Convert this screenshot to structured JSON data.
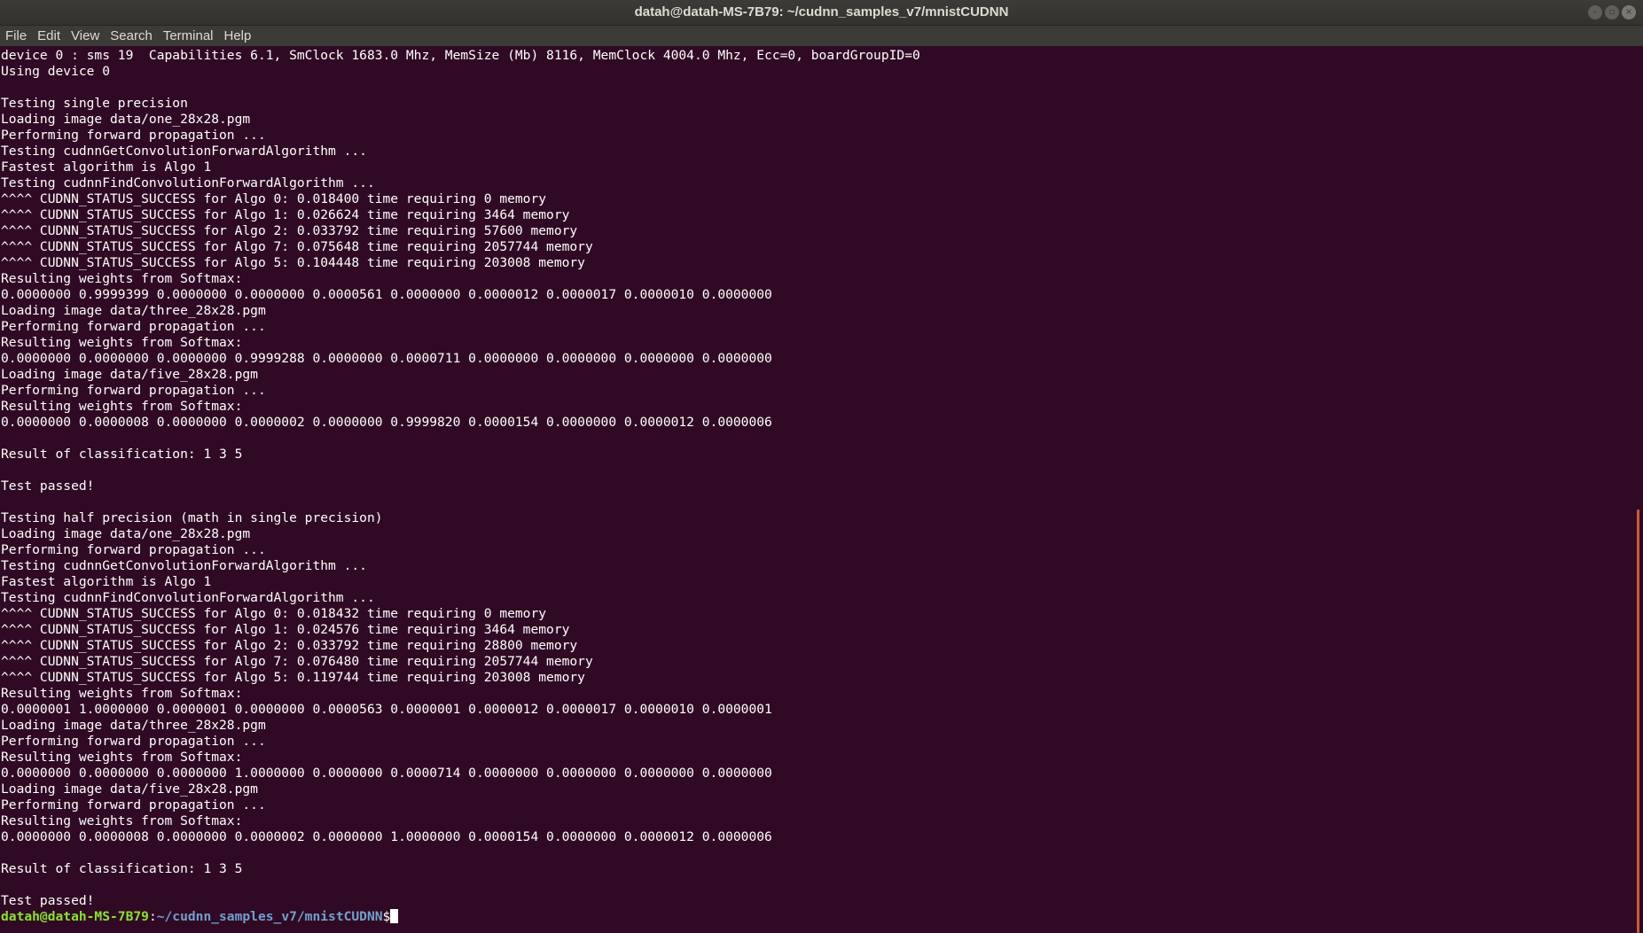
{
  "window": {
    "title": "datah@datah-MS-7B79: ~/cudnn_samples_v7/mnistCUDNN",
    "buttons": {
      "minimize": "–",
      "maximize": "▫",
      "close": "×"
    }
  },
  "menubar": {
    "items": [
      "File",
      "Edit",
      "View",
      "Search",
      "Terminal",
      "Help"
    ]
  },
  "terminal": {
    "lines": [
      "device 0 : sms 19  Capabilities 6.1, SmClock 1683.0 Mhz, MemSize (Mb) 8116, MemClock 4004.0 Mhz, Ecc=0, boardGroupID=0",
      "Using device 0",
      "",
      "Testing single precision",
      "Loading image data/one_28x28.pgm",
      "Performing forward propagation ...",
      "Testing cudnnGetConvolutionForwardAlgorithm ...",
      "Fastest algorithm is Algo 1",
      "Testing cudnnFindConvolutionForwardAlgorithm ...",
      "^^^^ CUDNN_STATUS_SUCCESS for Algo 0: 0.018400 time requiring 0 memory",
      "^^^^ CUDNN_STATUS_SUCCESS for Algo 1: 0.026624 time requiring 3464 memory",
      "^^^^ CUDNN_STATUS_SUCCESS for Algo 2: 0.033792 time requiring 57600 memory",
      "^^^^ CUDNN_STATUS_SUCCESS for Algo 7: 0.075648 time requiring 2057744 memory",
      "^^^^ CUDNN_STATUS_SUCCESS for Algo 5: 0.104448 time requiring 203008 memory",
      "Resulting weights from Softmax:",
      "0.0000000 0.9999399 0.0000000 0.0000000 0.0000561 0.0000000 0.0000012 0.0000017 0.0000010 0.0000000",
      "Loading image data/three_28x28.pgm",
      "Performing forward propagation ...",
      "Resulting weights from Softmax:",
      "0.0000000 0.0000000 0.0000000 0.9999288 0.0000000 0.0000711 0.0000000 0.0000000 0.0000000 0.0000000",
      "Loading image data/five_28x28.pgm",
      "Performing forward propagation ...",
      "Resulting weights from Softmax:",
      "0.0000000 0.0000008 0.0000000 0.0000002 0.0000000 0.9999820 0.0000154 0.0000000 0.0000012 0.0000006",
      "",
      "Result of classification: 1 3 5",
      "",
      "Test passed!",
      "",
      "Testing half precision (math in single precision)",
      "Loading image data/one_28x28.pgm",
      "Performing forward propagation ...",
      "Testing cudnnGetConvolutionForwardAlgorithm ...",
      "Fastest algorithm is Algo 1",
      "Testing cudnnFindConvolutionForwardAlgorithm ...",
      "^^^^ CUDNN_STATUS_SUCCESS for Algo 0: 0.018432 time requiring 0 memory",
      "^^^^ CUDNN_STATUS_SUCCESS for Algo 1: 0.024576 time requiring 3464 memory",
      "^^^^ CUDNN_STATUS_SUCCESS for Algo 2: 0.033792 time requiring 28800 memory",
      "^^^^ CUDNN_STATUS_SUCCESS for Algo 7: 0.076480 time requiring 2057744 memory",
      "^^^^ CUDNN_STATUS_SUCCESS for Algo 5: 0.119744 time requiring 203008 memory",
      "Resulting weights from Softmax:",
      "0.0000001 1.0000000 0.0000001 0.0000000 0.0000563 0.0000001 0.0000012 0.0000017 0.0000010 0.0000001",
      "Loading image data/three_28x28.pgm",
      "Performing forward propagation ...",
      "Resulting weights from Softmax:",
      "0.0000000 0.0000000 0.0000000 1.0000000 0.0000000 0.0000714 0.0000000 0.0000000 0.0000000 0.0000000",
      "Loading image data/five_28x28.pgm",
      "Performing forward propagation ...",
      "Resulting weights from Softmax:",
      "0.0000000 0.0000008 0.0000000 0.0000002 0.0000000 1.0000000 0.0000154 0.0000000 0.0000012 0.0000006",
      "",
      "Result of classification: 1 3 5",
      "",
      "Test passed!"
    ],
    "prompt": {
      "user_host": "datah@datah-MS-7B79",
      "separator": ":",
      "path": "~/cudnn_samples_v7/mnistCUDNN",
      "symbol": "$"
    }
  },
  "colors": {
    "background": "#300a24",
    "text": "#ffffff",
    "prompt_user": "#8ae234",
    "prompt_path": "#729fcf",
    "scrollbar_thumb": "#c85a36"
  },
  "scroll": {
    "thumb_position_fraction": 0.52,
    "thumb_size_fraction": 0.48
  }
}
